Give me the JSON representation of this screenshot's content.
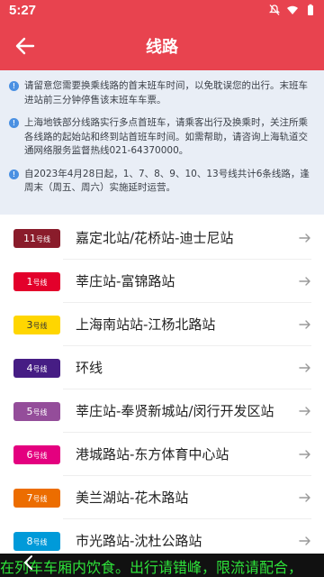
{
  "status": {
    "time": "5:27"
  },
  "header": {
    "title": "线路",
    "back_icon": "arrow-left-icon"
  },
  "notices": [
    "请留意您需要换乘线路的首末班车时间，以免耽误您的出行。末班车进站前三分钟停售该末班车车票。",
    "上海地铁部分线路实行多点首班车，请乘客出行及换乘时，关注所乘各线路的起始站和终到站首班车时间。如需帮助，请咨询上海轨道交通网络服务监督热线021-64370000。",
    "自2023年4月28日起，1、7、8、9、10、13号线共计6条线路，逢周末（周五、周六）实施延时运营。"
  ],
  "lines": [
    {
      "num": "11",
      "suffix": "号线",
      "name": "嘉定北站/花桥站-迪士尼站",
      "color": "#8a1c2b",
      "text_color": "#ffffff"
    },
    {
      "num": "1",
      "suffix": "号线",
      "name": "莘庄站-富锦路站",
      "color": "#e3002b",
      "text_color": "#ffffff"
    },
    {
      "num": "3",
      "suffix": "号线",
      "name": "上海南站站-江杨北路站",
      "color": "#ffd600",
      "text_color": "#333333"
    },
    {
      "num": "4",
      "suffix": "号线",
      "name": "环线",
      "color": "#461d84",
      "text_color": "#ffffff"
    },
    {
      "num": "5",
      "suffix": "号线",
      "name": "莘庄站-奉贤新城站/闵行开发区站",
      "color": "#944d9a",
      "text_color": "#ffffff"
    },
    {
      "num": "6",
      "suffix": "号线",
      "name": "港城路站-东方体育中心站",
      "color": "#e4007f",
      "text_color": "#ffffff"
    },
    {
      "num": "7",
      "suffix": "号线",
      "name": "美兰湖站-花木路站",
      "color": "#ec6d00",
      "text_color": "#ffffff"
    },
    {
      "num": "8",
      "suffix": "号线",
      "name": "市光路站-沈杜公路站",
      "color": "#009ad9",
      "text_color": "#ffffff"
    }
  ],
  "marquee": {
    "text": "在列车车厢内饮食。出行请错峰，限流请配合，"
  },
  "colors": {
    "brand": "#e8434f",
    "notice_bg": "#e9eef6",
    "marquee_text": "#2ee23a"
  }
}
